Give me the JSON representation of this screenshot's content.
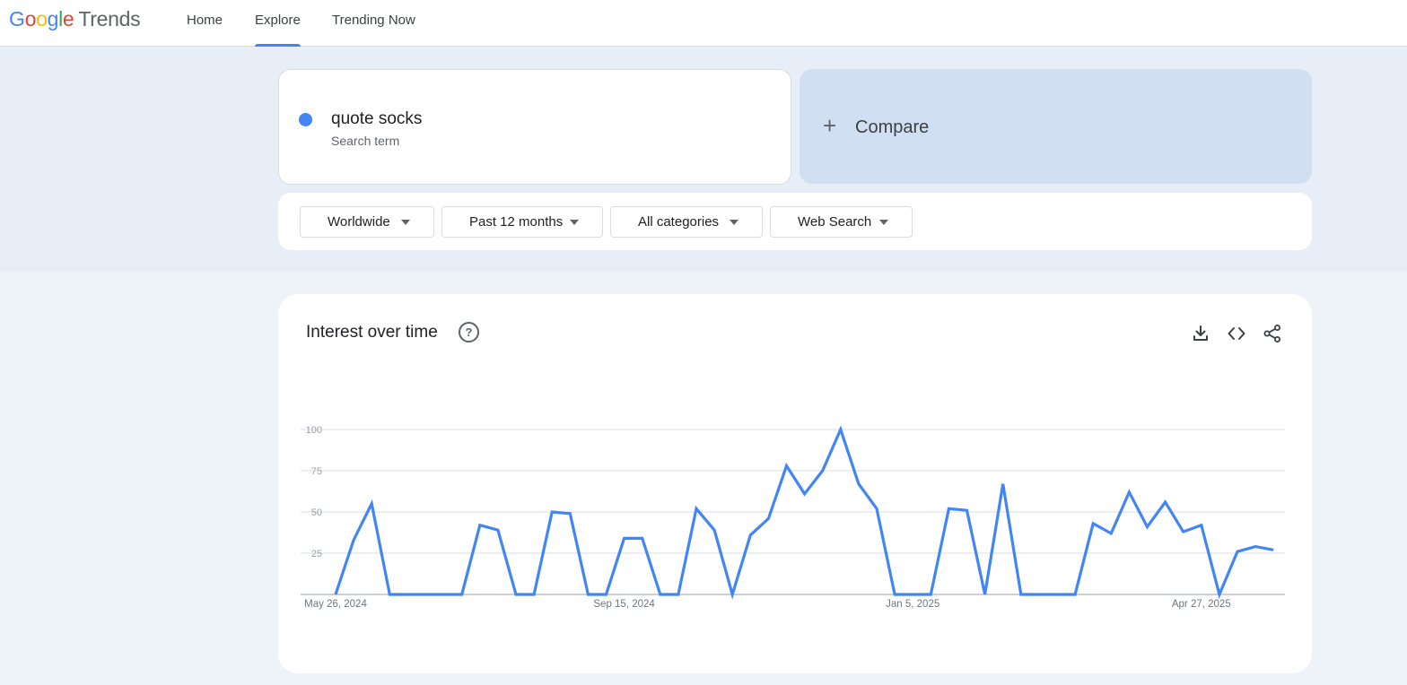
{
  "header": {
    "logo_google": "Google",
    "logo_trends": "Trends",
    "nav": [
      "Home",
      "Explore",
      "Trending Now"
    ],
    "active_nav": "Explore"
  },
  "search": {
    "term": "quote socks",
    "term_label": "Search term",
    "term_color": "#4285f4",
    "compare_label": "Compare"
  },
  "filters": {
    "region": "Worldwide",
    "time": "Past 12 months",
    "category": "All categories",
    "search_type": "Web Search"
  },
  "chart_panel": {
    "title": "Interest over time",
    "icons": [
      "help-icon",
      "download-icon",
      "embed-icon",
      "share-icon"
    ]
  },
  "chart_data": {
    "type": "line",
    "title": "",
    "xlabel": "",
    "ylabel": "",
    "ylim": [
      0,
      100
    ],
    "yticks": [
      25,
      50,
      75,
      100
    ],
    "grid": true,
    "x_tick_labels": [
      "May 26, 2024",
      "Sep 15, 2024",
      "Jan 5, 2025",
      "Apr 27, 2025"
    ],
    "x_tick_week_index": [
      0,
      16,
      32,
      48
    ],
    "series": [
      {
        "color": "#4285f4",
        "values": [
          0,
          33,
          55,
          0,
          0,
          0,
          0,
          0,
          42,
          39,
          0,
          0,
          50,
          49,
          0,
          0,
          34,
          34,
          0,
          0,
          52,
          39,
          0,
          36,
          46,
          78,
          61,
          75,
          100,
          67,
          52,
          0,
          0,
          0,
          52,
          51,
          0,
          67,
          0,
          0,
          0,
          0,
          43,
          37,
          62,
          41,
          56,
          38,
          42,
          0,
          26,
          29,
          27
        ]
      }
    ]
  }
}
